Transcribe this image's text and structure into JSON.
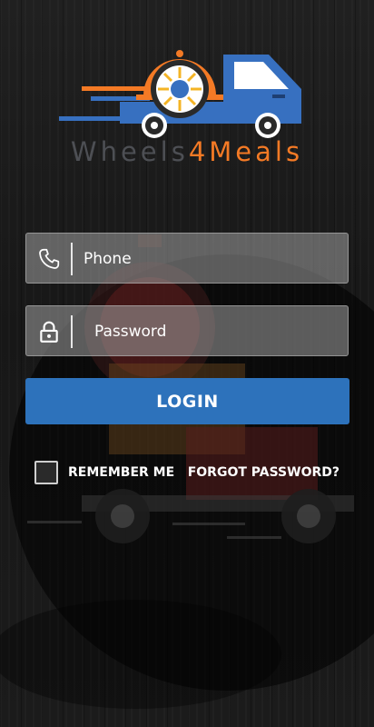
{
  "brand": {
    "name_part1": "Wheels",
    "name_part2": "4",
    "name_part3": "Meals"
  },
  "form": {
    "phone_placeholder": "Phone",
    "password_placeholder": "Password",
    "login_label": "LOGIN",
    "remember_label": "REMEMBER ME",
    "forgot_label": "FORGOT PASSWORD?"
  },
  "icons": {
    "phone": "phone-icon",
    "password": "lock-icon",
    "logo": "delivery-truck-logo"
  },
  "colors": {
    "primary": "#2d72bb",
    "accent": "#f47a25",
    "brand_gray": "#4d4f54",
    "truck_blue": "#3770c0"
  }
}
